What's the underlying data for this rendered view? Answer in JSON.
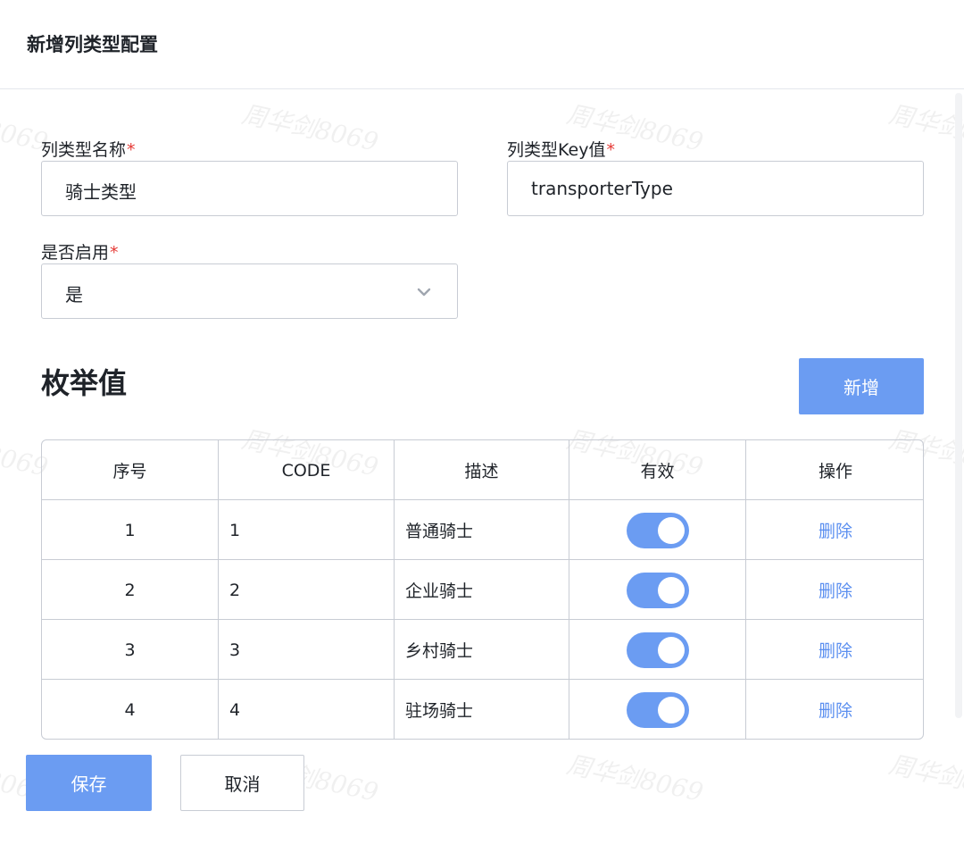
{
  "header": {
    "title": "新增列类型配置"
  },
  "watermark": {
    "text": "周华剑8069"
  },
  "form": {
    "name": {
      "label": "列类型名称",
      "required_mark": "*",
      "value": "骑士类型"
    },
    "key": {
      "label": "列类型Key值",
      "required_mark": "*",
      "value": "transporterType"
    },
    "enabled": {
      "label": "是否启用",
      "required_mark": "*",
      "value": "是"
    }
  },
  "enum_section": {
    "title": "枚举值",
    "add_label": "新增"
  },
  "table": {
    "columns": [
      "序号",
      "CODE",
      "描述",
      "有效",
      "操作"
    ],
    "rows": [
      {
        "index": "1",
        "code": "1",
        "desc": "普通骑士",
        "valid": true,
        "action": "删除"
      },
      {
        "index": "2",
        "code": "2",
        "desc": "企业骑士",
        "valid": true,
        "action": "删除"
      },
      {
        "index": "3",
        "code": "3",
        "desc": "乡村骑士",
        "valid": true,
        "action": "删除"
      },
      {
        "index": "4",
        "code": "4",
        "desc": "驻场骑士",
        "valid": true,
        "action": "删除"
      }
    ]
  },
  "footer": {
    "save_label": "保存",
    "cancel_label": "取消"
  },
  "colors": {
    "primary": "#6b9cf2",
    "link": "#5b8ff0",
    "required": "#e53935",
    "border": "#c8ccd4"
  },
  "icons": {
    "select_arrow": "chevron-down-icon"
  }
}
